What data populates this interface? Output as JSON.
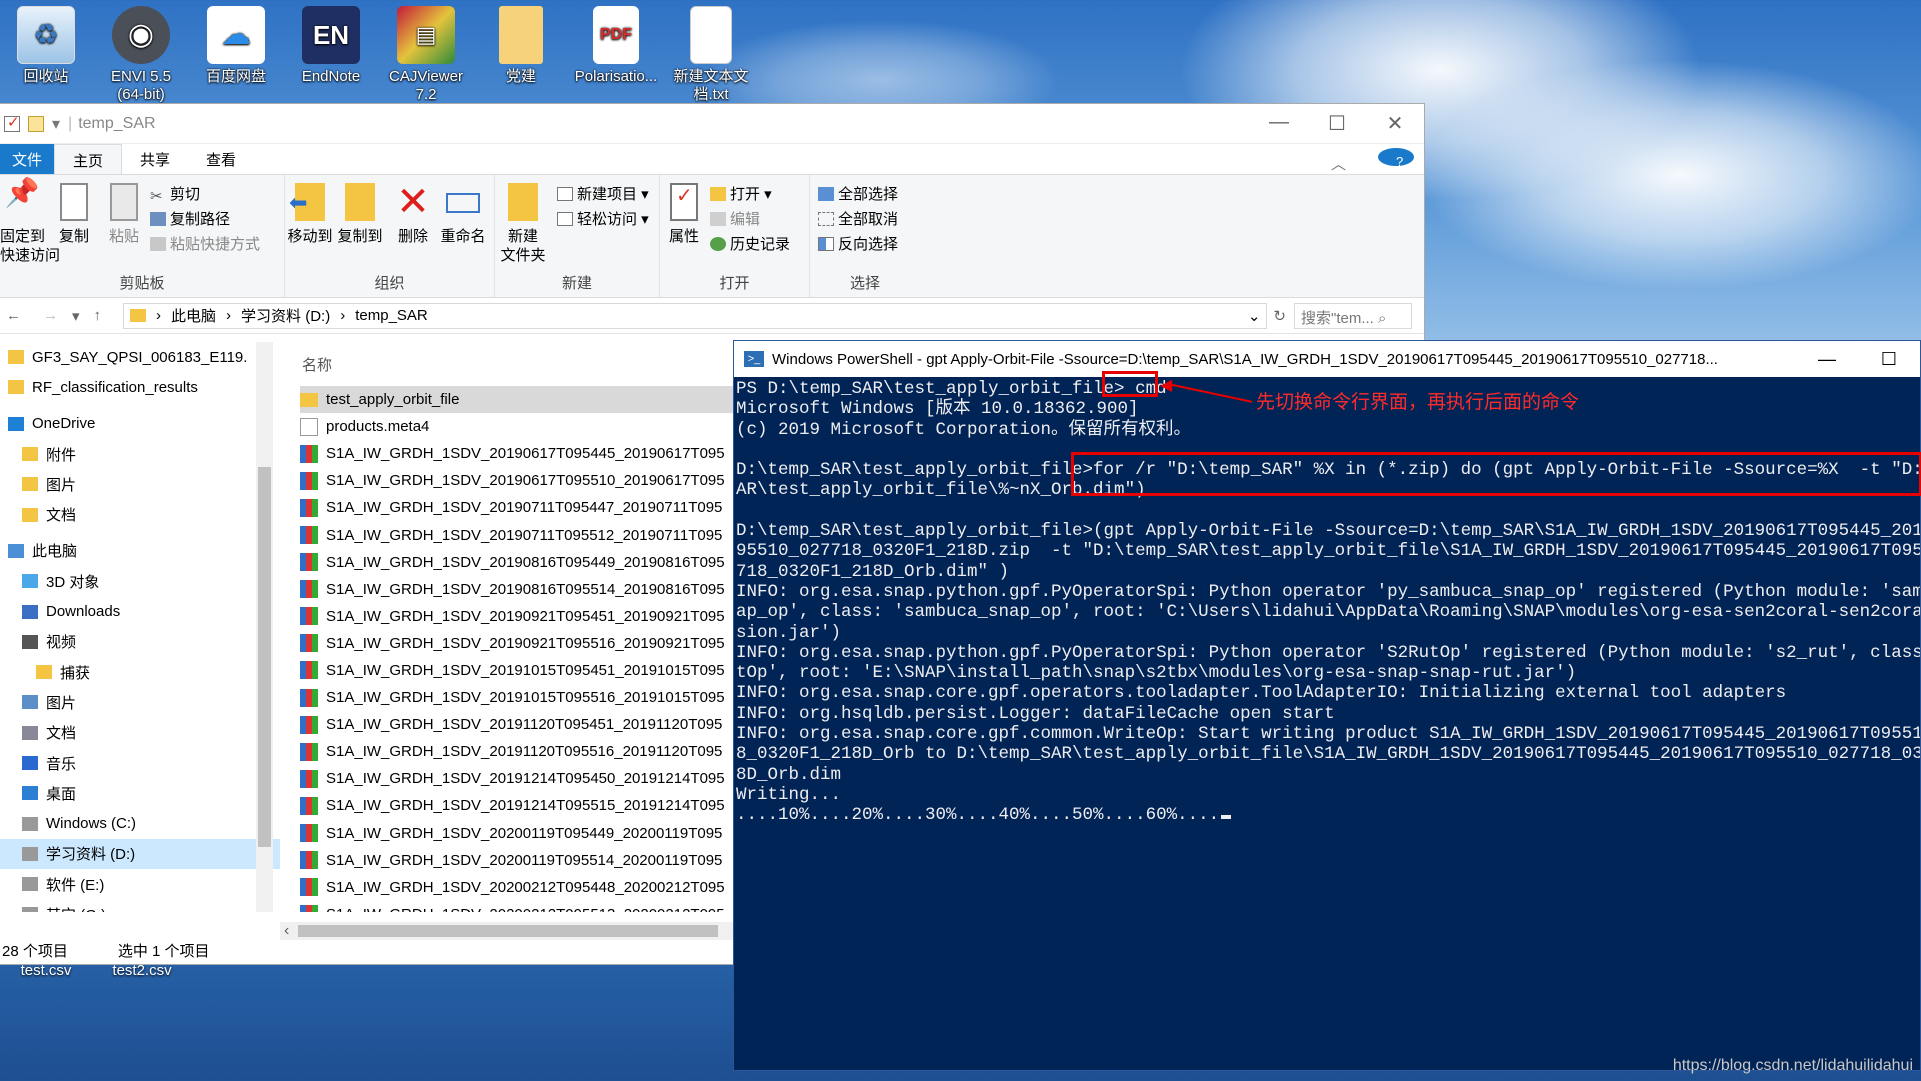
{
  "desktop_icons": [
    {
      "label": "回收站",
      "icon": "recycle-bin-icon"
    },
    {
      "label": "ENVI 5.5 (64-bit)",
      "icon": "envi-icon"
    },
    {
      "label": "百度网盘",
      "icon": "baidu-netdisk-icon"
    },
    {
      "label": "EndNote",
      "icon": "endnote-icon"
    },
    {
      "label": "CAJViewer 7.2",
      "icon": "cajviewer-icon"
    },
    {
      "label": "党建",
      "icon": "folder-icon"
    },
    {
      "label": "Polarisatio...",
      "icon": "pdf-icon"
    },
    {
      "label": "新建文本文档.txt",
      "icon": "text-file-icon"
    }
  ],
  "bottom_icons": [
    {
      "label": "test.csv"
    },
    {
      "label": "test2.csv"
    }
  ],
  "explorer": {
    "title": "temp_SAR",
    "window_controls": {
      "minimize": "—",
      "maximize": "☐",
      "close": "✕"
    },
    "tabs": {
      "file": "文件",
      "home": "主页",
      "share": "共享",
      "view": "查看"
    },
    "ribbon": {
      "clipboard": {
        "pin": "固定到\n快速访问",
        "copy": "复制",
        "paste": "粘贴",
        "cut": "剪切",
        "copy_path": "复制路径",
        "paste_shortcut": "粘贴快捷方式",
        "label": "剪贴板"
      },
      "organize": {
        "move_to": "移动到",
        "copy_to": "复制到",
        "delete": "删除",
        "rename": "重命名",
        "label": "组织"
      },
      "new": {
        "new_folder": "新建\n文件夹",
        "new_item": "新建项目 ▾",
        "easy_access": "轻松访问 ▾",
        "label": "新建"
      },
      "open": {
        "properties": "属性",
        "open": "打开 ▾",
        "edit": "编辑",
        "history": "历史记录",
        "label": "打开"
      },
      "select": {
        "select_all": "全部选择",
        "select_none": "全部取消",
        "invert": "反向选择",
        "label": "选择"
      }
    },
    "address": {
      "crumbs": [
        "此电脑",
        "学习资料 (D:)",
        "temp_SAR"
      ],
      "search_placeholder": "搜索\"tem..."
    },
    "nav_items": [
      {
        "label": "GF3_SAY_QPSI_006183_E119.",
        "icon": "folder-icon"
      },
      {
        "label": "RF_classification_results",
        "icon": "folder-icon"
      },
      {
        "label": "OneDrive",
        "icon": "onedrive-icon"
      },
      {
        "label": "附件",
        "icon": "folder-icon"
      },
      {
        "label": "图片",
        "icon": "folder-icon"
      },
      {
        "label": "文档",
        "icon": "folder-icon"
      },
      {
        "label": "此电脑",
        "icon": "computer-icon"
      },
      {
        "label": "3D 对象",
        "icon": "3d-objects-icon"
      },
      {
        "label": "Downloads",
        "icon": "download-icon"
      },
      {
        "label": "视频",
        "icon": "video-icon"
      },
      {
        "label": "捕获",
        "icon": "folder-icon"
      },
      {
        "label": "图片",
        "icon": "pictures-icon"
      },
      {
        "label": "文档",
        "icon": "documents-icon"
      },
      {
        "label": "音乐",
        "icon": "music-icon"
      },
      {
        "label": "桌面",
        "icon": "desktop-icon"
      },
      {
        "label": "Windows (C:)",
        "icon": "drive-icon"
      },
      {
        "label": "学习资料 (D:)",
        "icon": "drive-icon"
      },
      {
        "label": "软件 (E:)",
        "icon": "drive-icon"
      },
      {
        "label": "其它 (G:)",
        "icon": "drive-icon"
      }
    ],
    "column_name": "名称",
    "files": [
      {
        "name": "test_apply_orbit_file",
        "type": "folder"
      },
      {
        "name": "products.meta4",
        "type": "doc"
      },
      {
        "name": "S1A_IW_GRDH_1SDV_20190617T095445_20190617T095",
        "type": "zip"
      },
      {
        "name": "S1A_IW_GRDH_1SDV_20190617T095510_20190617T095",
        "type": "zip"
      },
      {
        "name": "S1A_IW_GRDH_1SDV_20190711T095447_20190711T095",
        "type": "zip"
      },
      {
        "name": "S1A_IW_GRDH_1SDV_20190711T095512_20190711T095",
        "type": "zip"
      },
      {
        "name": "S1A_IW_GRDH_1SDV_20190816T095449_20190816T095",
        "type": "zip"
      },
      {
        "name": "S1A_IW_GRDH_1SDV_20190816T095514_20190816T095",
        "type": "zip"
      },
      {
        "name": "S1A_IW_GRDH_1SDV_20190921T095451_20190921T095",
        "type": "zip"
      },
      {
        "name": "S1A_IW_GRDH_1SDV_20190921T095516_20190921T095",
        "type": "zip"
      },
      {
        "name": "S1A_IW_GRDH_1SDV_20191015T095451_20191015T095",
        "type": "zip"
      },
      {
        "name": "S1A_IW_GRDH_1SDV_20191015T095516_20191015T095",
        "type": "zip"
      },
      {
        "name": "S1A_IW_GRDH_1SDV_20191120T095451_20191120T095",
        "type": "zip"
      },
      {
        "name": "S1A_IW_GRDH_1SDV_20191120T095516_20191120T095",
        "type": "zip"
      },
      {
        "name": "S1A_IW_GRDH_1SDV_20191214T095450_20191214T095",
        "type": "zip"
      },
      {
        "name": "S1A_IW_GRDH_1SDV_20191214T095515_20191214T095",
        "type": "zip"
      },
      {
        "name": "S1A_IW_GRDH_1SDV_20200119T095449_20200119T095",
        "type": "zip"
      },
      {
        "name": "S1A_IW_GRDH_1SDV_20200119T095514_20200119T095",
        "type": "zip"
      },
      {
        "name": "S1A_IW_GRDH_1SDV_20200212T095448_20200212T095",
        "type": "zip"
      },
      {
        "name": "S1A_IW_GRDH_1SDV_20200212T095513_20200212T095",
        "type": "zip"
      }
    ],
    "status": {
      "count": "28 个项目",
      "selected": "选中 1 个项目"
    }
  },
  "powershell": {
    "title": "Windows PowerShell - gpt  Apply-Orbit-File -Ssource=D:\\temp_SAR\\S1A_IW_GRDH_1SDV_20190617T095445_20190617T095510_027718...",
    "lines": [
      "PS D:\\temp_SAR\\test_apply_orbit_file> cmd",
      "Microsoft Windows [版本 10.0.18362.900]",
      "(c) 2019 Microsoft Corporation。保留所有权利。",
      "",
      "D:\\temp_SAR\\test_apply_orbit_file>for /r \"D:\\temp_SAR\" %X in (*.zip) do (gpt Apply-Orbit-File -Ssource=%X  -t \"D:\\temp_S",
      "AR\\test_apply_orbit_file\\%~nX_Orb.dim\")",
      "",
      "D:\\temp_SAR\\test_apply_orbit_file>(gpt Apply-Orbit-File -Ssource=D:\\temp_SAR\\S1A_IW_GRDH_1SDV_20190617T095445_20190617T",
      "95510_027718_0320F1_218D.zip  -t \"D:\\temp_SAR\\test_apply_orbit_file\\S1A_IW_GRDH_1SDV_20190617T095445_20190617T095510_02",
      "718_0320F1_218D_Orb.dim\" )",
      "INFO: org.esa.snap.python.gpf.PyOperatorSpi: Python operator 'py_sambuca_snap_op' registered (Python module: 'sambuca_sn",
      "ap_op', class: 'sambuca_snap_op', root: 'C:\\Users\\lidahui\\AppData\\Roaming\\SNAP\\modules\\org-esa-sen2coral-sen2coral-inver",
      "sion.jar')",
      "INFO: org.esa.snap.python.gpf.PyOperatorSpi: Python operator 'S2RutOp' registered (Python module: 's2_rut', class: 'S2Ru",
      "tOp', root: 'E:\\SNAP\\install_path\\snap\\s2tbx\\modules\\org-esa-snap-snap-rut.jar')",
      "INFO: org.esa.snap.core.gpf.operators.tooladapter.ToolAdapterIO: Initializing external tool adapters",
      "INFO: org.hsqldb.persist.Logger: dataFileCache open start",
      "INFO: org.esa.snap.core.gpf.common.WriteOp: Start writing product S1A_IW_GRDH_1SDV_20190617T095445_20190617T095510_0277",
      "8_0320F1_218D_Orb to D:\\temp_SAR\\test_apply_orbit_file\\S1A_IW_GRDH_1SDV_20190617T095445_20190617T095510_027718_0320F1_21",
      "8D_Orb.dim",
      "Writing...",
      "....10%....20%....30%....40%....50%....60%...."
    ],
    "annotation": "先切换命令行界面，再执行后面的命令",
    "colors": {
      "background": "#012456",
      "text": "#eeedf0",
      "highlight": "#e60000"
    }
  },
  "watermark": "https://blog.csdn.net/lidahuilidahui"
}
